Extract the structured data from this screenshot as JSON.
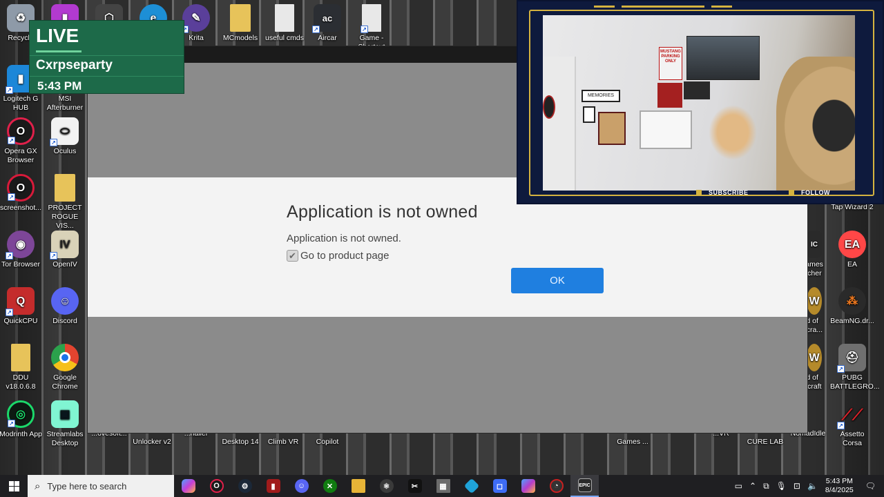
{
  "desktop": {
    "icons": [
      {
        "label": "Recycle",
        "icon": "recycle-bin-icon",
        "color": "#8e9aa8"
      },
      {
        "label": "",
        "icon": "app-icon",
        "color": "#b23ad0"
      },
      {
        "label": "",
        "icon": "box-icon",
        "color": "#444444"
      },
      {
        "label": "",
        "icon": "edge-icon",
        "color": "#1d8fd6"
      },
      {
        "label": "Krita",
        "icon": "krita-icon",
        "color": "#5a3f9a"
      },
      {
        "label": "MCmodels",
        "icon": "folder-icon",
        "color": "#e7c35a"
      },
      {
        "label": "useful cmds",
        "icon": "file-icon",
        "color": "#e8e8e8"
      },
      {
        "label": "Aircar",
        "icon": "aircar-icon",
        "color": "#2b2e33"
      },
      {
        "label": "Game - Shortcut",
        "icon": "file-icon",
        "color": "#e8e8e8"
      },
      {
        "label": "Logitech G HUB",
        "icon": "logitech-icon",
        "color": "#1c87d8"
      },
      {
        "label": "MSI Afterburner",
        "icon": "msi-icon",
        "color": "#a01b1b"
      },
      {
        "label": "Opera GX Browser",
        "icon": "opera-gx-icon",
        "color": "#e0204a"
      },
      {
        "label": "Oculus",
        "icon": "oculus-icon",
        "color": "#f2f2f2"
      },
      {
        "label": "screenshot...",
        "icon": "opera-icon",
        "color": "#d81a3a"
      },
      {
        "label": "PROJECT ROGUE VIS...",
        "icon": "folder-icon",
        "color": "#e7c35a"
      },
      {
        "label": "Tor Browser",
        "icon": "tor-icon",
        "color": "#7d4698"
      },
      {
        "label": "OpenIV",
        "icon": "openiv-icon",
        "color": "#d9d2b8"
      },
      {
        "label": "QuickCPU",
        "icon": "quickcpu-icon",
        "color": "#c42c2c"
      },
      {
        "label": "Discord",
        "icon": "discord-icon",
        "color": "#5865f2"
      },
      {
        "label": "DDU v18.0.6.8",
        "icon": "folder-icon",
        "color": "#e7c35a"
      },
      {
        "label": "Google Chrome",
        "icon": "chrome-icon",
        "color": "#e2442f"
      },
      {
        "label": "Modrinth App",
        "icon": "modrinth-icon",
        "color": "#1bd96a"
      },
      {
        "label": "Streamlabs Desktop",
        "icon": "streamlabs-icon",
        "color": "#80f5d2"
      },
      {
        "label": "Tap Wizard 2",
        "icon": "app-icon",
        "color": "#3a3a3a"
      },
      {
        "label": "Games ...cher",
        "icon": "epic-icon",
        "color": "#2a2a2a"
      },
      {
        "label": "EA",
        "icon": "ea-icon",
        "color": "#ff4747"
      },
      {
        "label": "ld of ...cra...",
        "icon": "wow-icon",
        "color": "#b58a2a"
      },
      {
        "label": "BeamNG.dr...",
        "icon": "beamng-icon",
        "color": "#f07a20"
      },
      {
        "label": "ld of ...craft",
        "icon": "wow-icon",
        "color": "#b58a2a"
      },
      {
        "label": "PUBG BATTLEGRO...",
        "icon": "pubg-icon",
        "color": "#c9c9c9"
      },
      {
        "label": "Assetto Corsa",
        "icon": "assetto-corsa-icon",
        "color": "#d8232a"
      }
    ],
    "bottom_labels": [
      "...ovesoft...",
      "Unlocker v2",
      "...naller",
      "Desktop 14",
      "Climb VR",
      "Copilot",
      "Games ...",
      "...VR",
      "CURE LAB",
      "NomadIdle"
    ]
  },
  "live_overlay": {
    "status": "LIVE",
    "name": "Cxrpseparty",
    "time": "5:43 PM",
    "color": "#1d6a49"
  },
  "webcam": {
    "subscribe": "SUBSCRIBE",
    "follow": "FOLLOW",
    "accent": "#d5b340",
    "poster_text": "MUSTANG PARKING ONLY",
    "sign_text": "MEMORIES"
  },
  "dialog": {
    "title": "Application is not owned",
    "message": "Application is not owned.",
    "checkbox_label": "Go to product page",
    "checkbox_checked": true,
    "ok_label": "OK",
    "ok_color": "#1f7fe0"
  },
  "taskbar": {
    "search_placeholder": "Type here to search",
    "apps": [
      {
        "icon": "copilot-icon",
        "color": "#c53ed8"
      },
      {
        "icon": "opera-gx-icon",
        "color": "#e0204a"
      },
      {
        "icon": "steam-icon",
        "color": "#1b2838"
      },
      {
        "icon": "msi-icon",
        "color": "#a01b1b"
      },
      {
        "icon": "discord-icon",
        "color": "#5865f2"
      },
      {
        "icon": "xbox-icon",
        "color": "#107c10"
      },
      {
        "icon": "file-explorer-icon",
        "color": "#e7b437"
      },
      {
        "icon": "atom-icon",
        "color": "#3a3a3a"
      },
      {
        "icon": "capcut-icon",
        "color": "#111111"
      },
      {
        "icon": "minecraft-icon",
        "color": "#6b6b6b"
      },
      {
        "icon": "kodi-icon",
        "color": "#1fa3d9"
      },
      {
        "icon": "roblox-icon",
        "color": "#3e6cf5"
      },
      {
        "icon": "copilot-pc-icon",
        "color": "#b43ccc"
      },
      {
        "icon": "performance-icon",
        "color": "#c82020"
      },
      {
        "icon": "epic-games-icon",
        "color": "#2a2a2a"
      }
    ],
    "time": "5:43 PM",
    "date": "8/4/2025"
  }
}
